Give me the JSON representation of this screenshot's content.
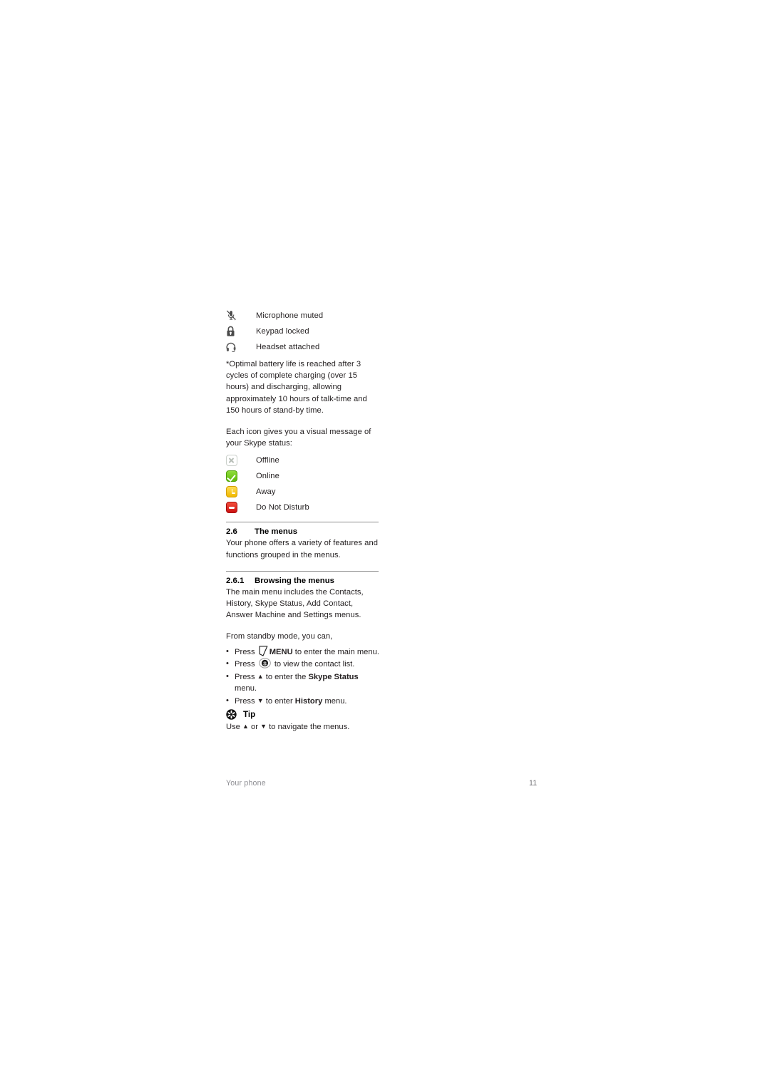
{
  "document": {
    "page_number": "11",
    "footer_section": "Your phone"
  },
  "phone_status_icons": [
    {
      "icon": "microphone-muted-icon",
      "label": "Microphone muted"
    },
    {
      "icon": "padlock-icon",
      "label": "Keypad locked"
    },
    {
      "icon": "headset-icon",
      "label": "Headset attached"
    }
  ],
  "battery_footnote": "*Optimal battery life is reached after 3 cycles of complete charging (over 15 hours) and discharging, allowing approximately 10 hours of talk-time and 150 hours of stand-by time.",
  "skype_status_intro": "Each icon gives you a visual message of your Skype status:",
  "skype_status_icons": [
    {
      "icon": "offline-icon",
      "label": "Offline",
      "color": "#b7beb7"
    },
    {
      "icon": "online-icon",
      "label": "Online",
      "color": "#5fbb0a"
    },
    {
      "icon": "away-icon",
      "label": "Away",
      "color": "#f0b800"
    },
    {
      "icon": "do-not-disturb-icon",
      "label": "Do Not Disturb",
      "color": "#cc1111"
    }
  ],
  "section_2_6": {
    "number": "2.6",
    "title": "The menus",
    "body": "Your phone offers a variety of features and functions grouped in the menus."
  },
  "section_2_6_1": {
    "number": "2.6.1",
    "title": "Browsing the menus",
    "body": "The main menu includes the Contacts, History, Skype Status, Add Contact, Answer Machine and Settings menus.",
    "standby_intro": "From standby mode, you can,",
    "bullets": [
      {
        "marker": "•",
        "pre": "Press",
        "icon": "soft-key-menu-icon",
        "bold1": "MENU",
        "post": " to enter the main menu."
      },
      {
        "marker": "•",
        "pre": "Press",
        "icon": "skype-round-button-icon",
        "bold1": "",
        "post": " to view the contact list."
      },
      {
        "marker": "•",
        "pre": "Press",
        "icon": "up-arrow-icon",
        "glyph": "▲",
        "mid": " to enter the ",
        "bold1": "Skype Status",
        "post": " menu."
      },
      {
        "marker": "•",
        "pre": "Press",
        "icon": "down-arrow-icon",
        "glyph": "▼",
        "mid": " to enter ",
        "bold1": "History",
        "post": " menu."
      }
    ]
  },
  "tip": {
    "icon": "tip-star-icon",
    "label": "Tip",
    "text_before": "Use ",
    "up_glyph": "▲",
    "text_mid": " or ",
    "down_glyph": "▼",
    "text_after": " to navigate the menus."
  }
}
